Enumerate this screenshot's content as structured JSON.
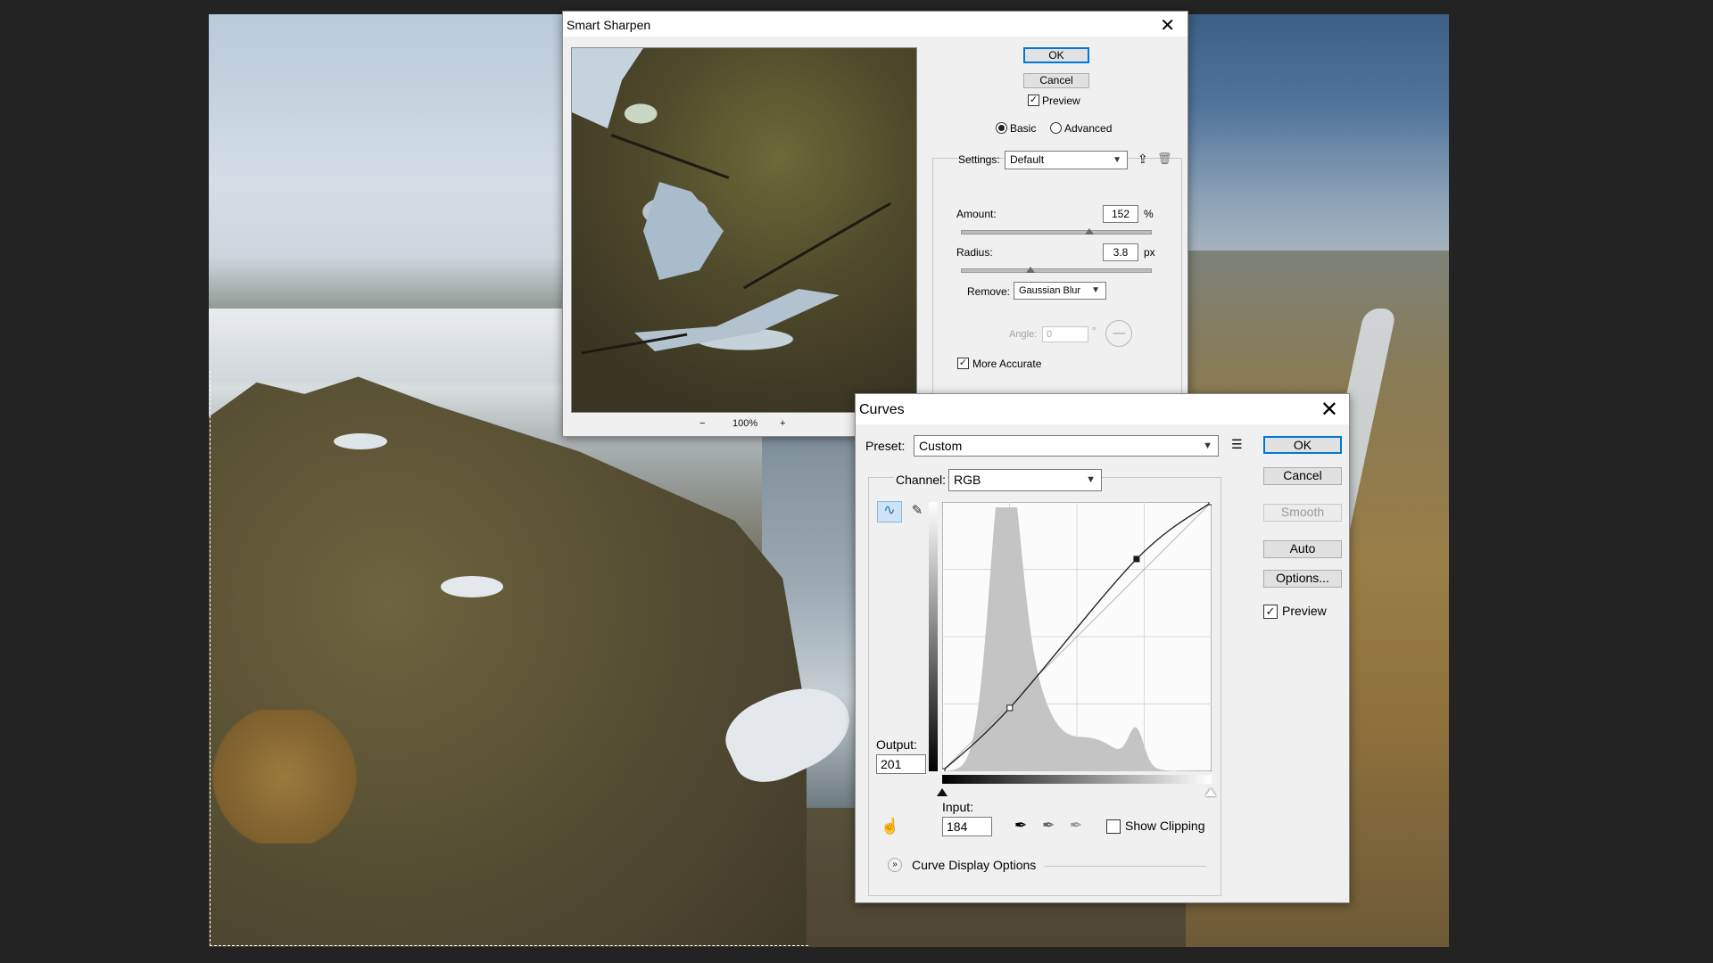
{
  "smart_sharpen": {
    "title": "Smart Sharpen",
    "ok": "OK",
    "cancel": "Cancel",
    "preview_label": "Preview",
    "preview_checked": true,
    "mode_basic": "Basic",
    "mode_advanced": "Advanced",
    "settings_label": "Settings:",
    "settings_value": "Default",
    "amount_label": "Amount:",
    "amount_value": "152",
    "amount_unit": "%",
    "amount_fraction": 0.68,
    "radius_label": "Radius:",
    "radius_value": "3.8",
    "radius_unit": "px",
    "radius_fraction": 0.37,
    "remove_label": "Remove:",
    "remove_value": "Gaussian Blur",
    "angle_label": "Angle:",
    "angle_value": "0",
    "angle_unit": "°",
    "more_accurate_label": "More Accurate",
    "more_accurate_checked": true,
    "zoom_value": "100%",
    "zoom_out": "−",
    "zoom_in": "+"
  },
  "curves": {
    "title": "Curves",
    "preset_label": "Preset:",
    "preset_value": "Custom",
    "channel_label": "Channel:",
    "channel_value": "RGB",
    "output_label": "Output:",
    "output_value": "201",
    "input_label": "Input:",
    "input_value": "184",
    "show_clipping_label": "Show Clipping",
    "curve_display_options": "Curve Display Options",
    "buttons": {
      "ok": "OK",
      "cancel": "Cancel",
      "smooth": "Smooth",
      "auto": "Auto",
      "options": "Options..."
    },
    "preview_label": "Preview",
    "preview_checked": true,
    "curve_points": [
      [
        0,
        0
      ],
      [
        64,
        60
      ],
      [
        184,
        201
      ],
      [
        255,
        255
      ]
    ],
    "colors": {
      "accent": "#0078d7",
      "histogram": "#c4c4c4",
      "grid": "#d8d8d8"
    }
  }
}
